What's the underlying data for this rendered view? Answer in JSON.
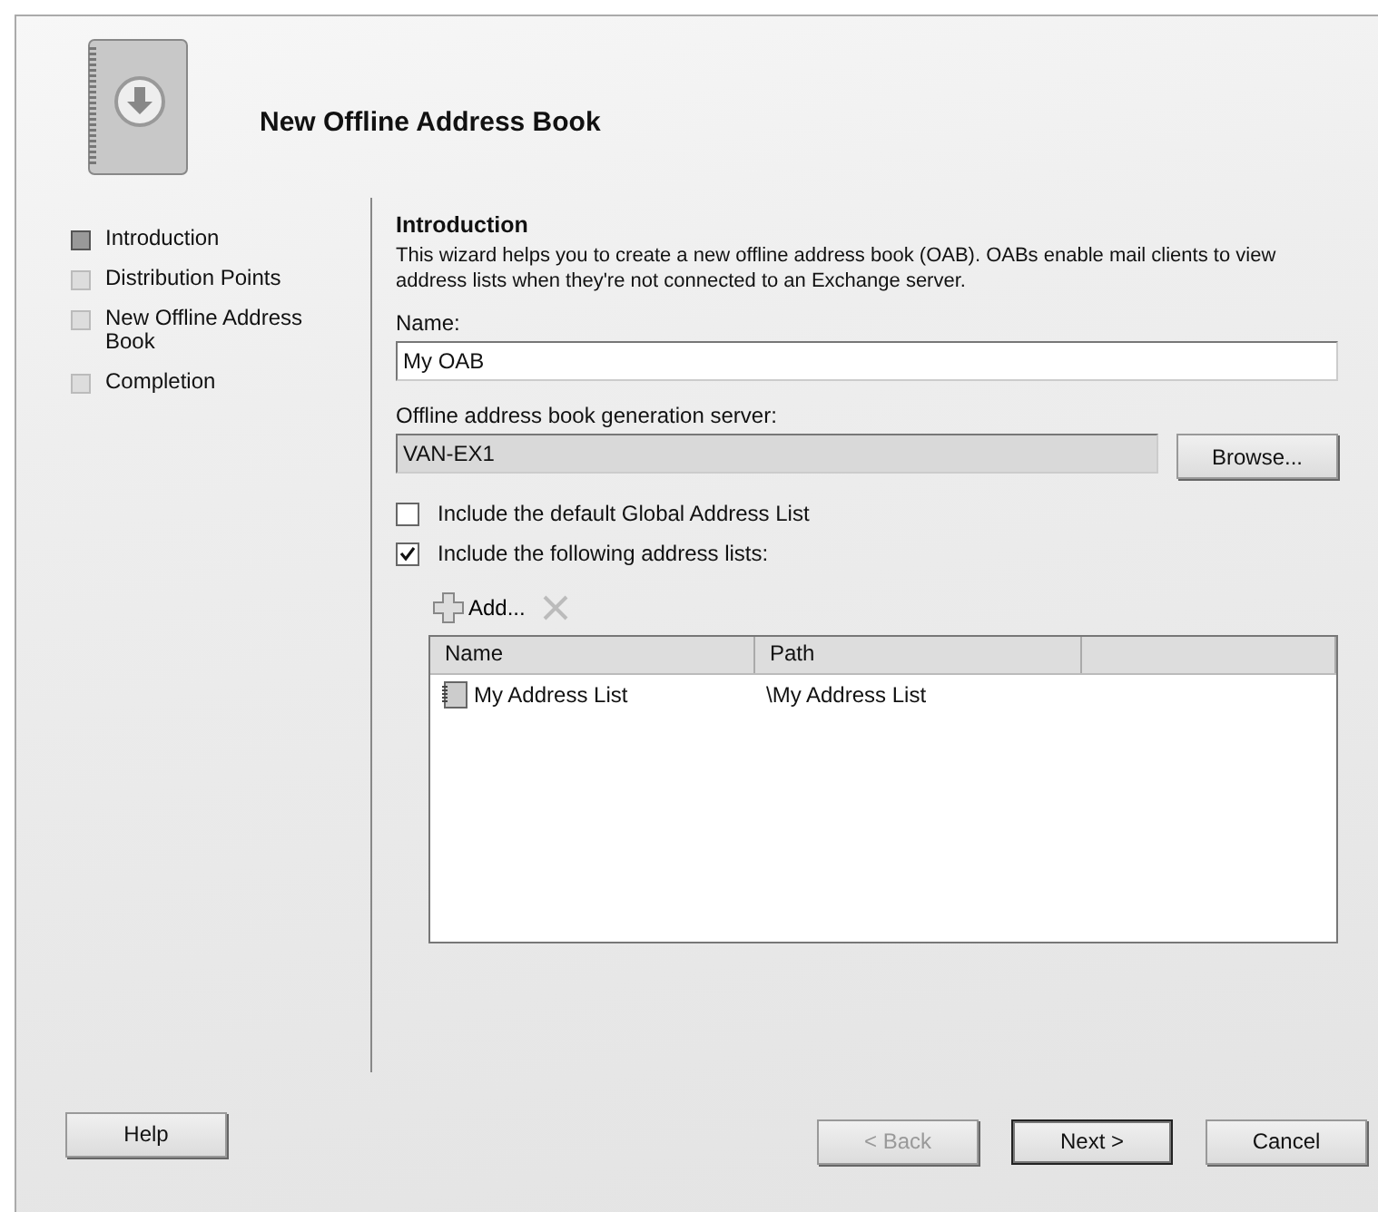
{
  "window": {
    "title": "New Offline Address Book"
  },
  "steps": [
    {
      "label": "Introduction",
      "selected": true
    },
    {
      "label": "Distribution Points",
      "selected": false
    },
    {
      "label": "New Offline Address Book",
      "selected": false
    },
    {
      "label": "Completion",
      "selected": false
    }
  ],
  "page": {
    "heading": "Introduction",
    "description": "This wizard helps you to create a new offline address book (OAB). OABs enable mail clients to view address lists when they're not connected to an Exchange server.",
    "name_label": "Name:",
    "name_value": "My OAB",
    "server_label": "Offline address book generation server:",
    "server_value": "VAN-EX1",
    "browse_button": "Browse...",
    "options": [
      {
        "label": "Include the default Global Address List",
        "checked": false
      },
      {
        "label": "Include the following address lists:",
        "checked": true
      }
    ],
    "toolbar": {
      "add_label": "Add...",
      "remove_disabled": true
    },
    "table": {
      "columns": [
        "Name",
        "Path"
      ],
      "rows": [
        {
          "name": "My Address List",
          "path": "\\My Address List"
        }
      ]
    }
  },
  "buttons": [
    {
      "label": "Help",
      "kind": "help",
      "disabled": false
    },
    {
      "label": "< Back",
      "kind": "nav",
      "disabled": true
    },
    {
      "label": "Next >",
      "kind": "default",
      "disabled": false
    },
    {
      "label": "Cancel",
      "kind": "nav",
      "disabled": false
    }
  ]
}
